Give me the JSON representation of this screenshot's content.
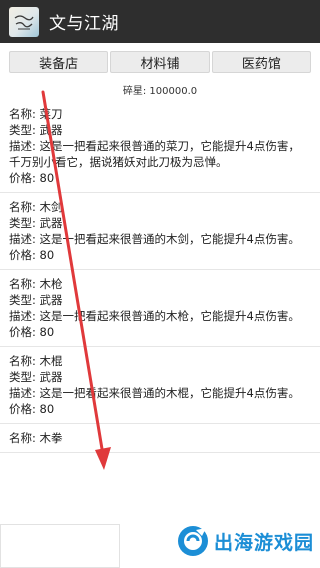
{
  "app": {
    "title": "文与江湖",
    "icon": "calligraphy-app-icon"
  },
  "tabs": [
    {
      "label": "装备店"
    },
    {
      "label": "材料铺"
    },
    {
      "label": "医药馆"
    }
  ],
  "currency": {
    "label": "碎星: 100000.0"
  },
  "items": [
    {
      "name": "名称: 菜刀",
      "type": "类型: 武器",
      "desc": "描述: 这是一把看起来很普通的菜刀，它能提升4点伤害，千万别小看它，据说猪妖对此刀极为忌惮。",
      "price": "价格: 80"
    },
    {
      "name": "名称: 木剑",
      "type": "类型: 武器",
      "desc": "描述: 这是一把看起来很普通的木剑，它能提升4点伤害。",
      "price": "价格: 80"
    },
    {
      "name": "名称: 木枪",
      "type": "类型: 武器",
      "desc": "描述: 这是一把看起来很普通的木枪，它能提升4点伤害。",
      "price": "价格: 80"
    },
    {
      "name": "名称: 木棍",
      "type": "类型: 武器",
      "desc": "描述: 这是一把看起来很普通的木棍，它能提升4点伤害。",
      "price": "价格: 80"
    },
    {
      "name": "名称: 木拳",
      "type": "",
      "desc": "",
      "price": ""
    }
  ],
  "watermark": {
    "text": "出海游戏园",
    "color": "#1c8ed6"
  },
  "colors": {
    "appbar": "#2e2e2e",
    "arrow": "#e0393b"
  }
}
